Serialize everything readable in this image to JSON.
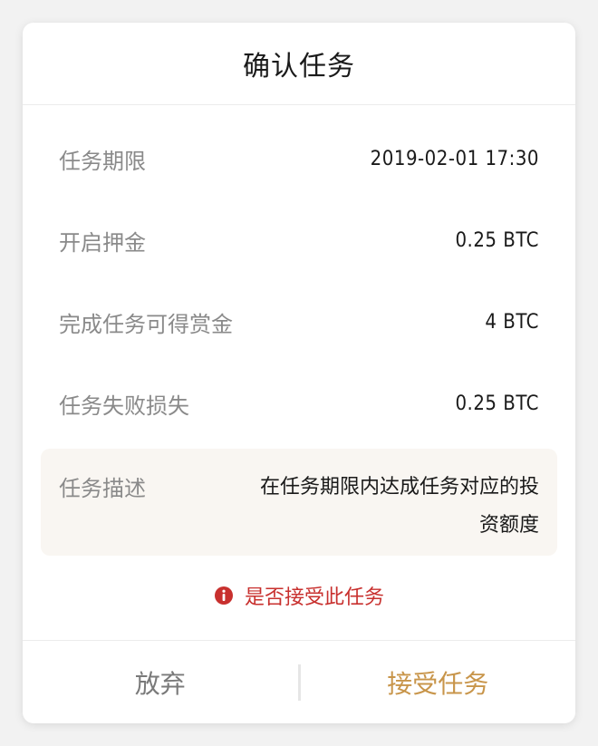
{
  "dialog": {
    "title": "确认任务",
    "rows": [
      {
        "label": "任务期限",
        "value": "2019-02-01 17:30"
      },
      {
        "label": "开启押金",
        "value": "0.25 BTC"
      },
      {
        "label": "完成任务可得赏金",
        "value": "4 BTC"
      },
      {
        "label": "任务失败损失",
        "value": "0.25 BTC"
      }
    ],
    "description": {
      "label": "任务描述",
      "text": "在任务期限内达成任务对应的投资额度"
    },
    "confirm_message": {
      "icon": "info-circle-icon",
      "text": "是否接受此任务"
    },
    "buttons": {
      "cancel_label": "放弃",
      "accept_label": "接受任务"
    }
  },
  "colors": {
    "accent": "#c8954a",
    "warning": "#c8302e",
    "label_gray": "#8a8a8a",
    "description_bg": "#f9f6f2"
  }
}
